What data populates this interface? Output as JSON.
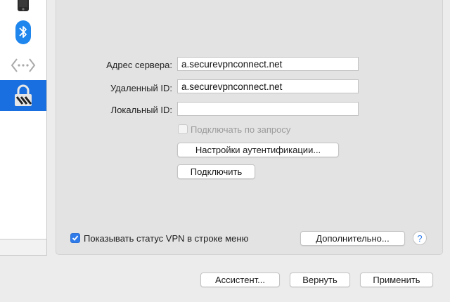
{
  "sidebar": {
    "items": [
      {
        "icon": "phone-icon"
      },
      {
        "icon": "bluetooth-icon"
      },
      {
        "icon": "network-dots-icon"
      },
      {
        "icon": "vpn-lock-icon",
        "selected": true
      }
    ]
  },
  "form": {
    "server_label": "Адрес сервера:",
    "server_value": "a.securevpnconnect.net",
    "remote_id_label": "Удаленный ID:",
    "remote_id_value": "a.securevpnconnect.net",
    "local_id_label": "Локальный ID:",
    "local_id_value": "",
    "connect_on_demand_label": "Подключать по запросу",
    "connect_on_demand_checked": false,
    "auth_settings_button": "Настройки аутентификации...",
    "connect_button": "Подключить"
  },
  "footer": {
    "show_status_label": "Показывать статус VPN в строке меню",
    "show_status_checked": true,
    "advanced_button": "Дополнительно...",
    "help_glyph": "?"
  },
  "bottom_bar": {
    "assistant_button": "Ассистент...",
    "revert_button": "Вернуть",
    "apply_button": "Применить"
  },
  "colors": {
    "accent": "#1a6fe0",
    "checkbox_on": "#2f7bea"
  }
}
